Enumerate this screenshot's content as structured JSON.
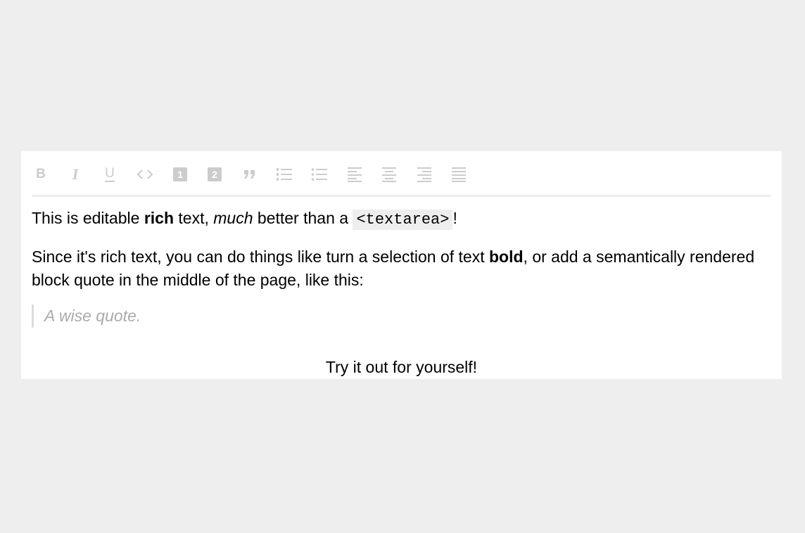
{
  "toolbar": {
    "buttons": [
      {
        "icon": "bold-icon",
        "label": "B"
      },
      {
        "icon": "italic-icon",
        "label": "I"
      },
      {
        "icon": "underline-icon",
        "label": "U"
      },
      {
        "icon": "code-icon",
        "label": "<>"
      },
      {
        "icon": "heading-one-icon",
        "label": "1"
      },
      {
        "icon": "heading-two-icon",
        "label": "2"
      },
      {
        "icon": "block-quote-icon",
        "label": ""
      },
      {
        "icon": "numbered-list-icon",
        "label": ""
      },
      {
        "icon": "bulleted-list-icon",
        "label": ""
      },
      {
        "icon": "align-left-icon",
        "label": ""
      },
      {
        "icon": "align-center-icon",
        "label": ""
      },
      {
        "icon": "align-right-icon",
        "label": ""
      },
      {
        "icon": "align-justify-icon",
        "label": ""
      }
    ],
    "icon_color": "#cccccc"
  },
  "document": {
    "p1": {
      "t1": "This is editable ",
      "bold": "rich",
      "t2": " text, ",
      "italic": "much",
      "t3": " better than a ",
      "code": "<textarea>",
      "t4": "!"
    },
    "p2": {
      "t1": "Since it's rich text, you can do things like turn a selection of text ",
      "bold": "bold",
      "t2": ", or add a semantically rendered block quote in the middle of the page, like this:"
    },
    "quote": "A wise quote.",
    "p3": "Try it out for yourself!"
  },
  "colors": {
    "page_background": "#eeeeee",
    "editor_background": "#ffffff",
    "quote_text": "#aaaaaa",
    "quote_border": "#dddddd",
    "code_background": "#eeeeee"
  }
}
